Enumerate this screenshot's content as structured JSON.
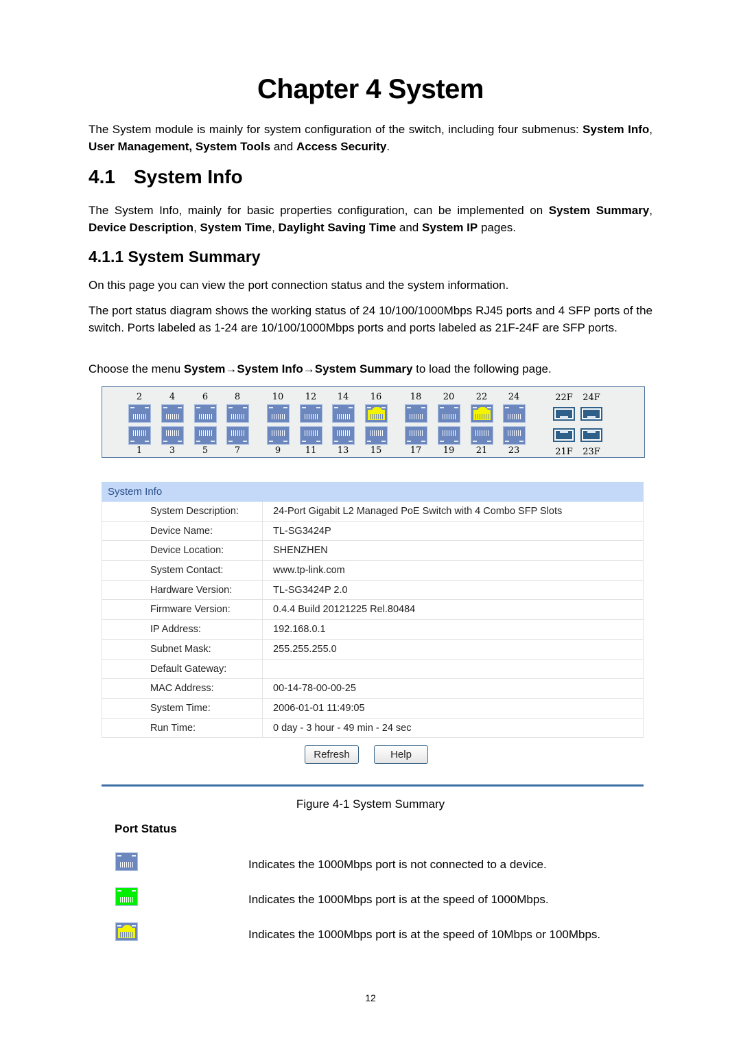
{
  "chapter": {
    "title": "Chapter 4  System"
  },
  "intro": {
    "text_before": "The System module is mainly for system configuration of the switch, including four submenus: ",
    "b1": "System Info",
    "sep1": ", ",
    "b2": "User Management, System Tools",
    "sep2": " and ",
    "b3": "Access Security",
    "end": "."
  },
  "section_4_1": {
    "number": "4.1",
    "title": "System Info",
    "p_before": "The System Info, mainly for basic properties configuration, can be implemented on ",
    "b1": "System Summary",
    "s1": ", ",
    "b2": "Device Description",
    "s2": ", ",
    "b3": "System Time",
    "s3": ", ",
    "b4": "Daylight Saving Time",
    "s4": " and ",
    "b5": "System IP",
    "end": " pages."
  },
  "section_4_1_1": {
    "title": "4.1.1 System Summary",
    "p1": "On this page you can view the port connection status and the system information.",
    "p2": "The port status diagram shows the working status of 24 10/100/1000Mbps RJ45 ports and 4 SFP ports of the switch. Ports labeled as 1-24 are 10/100/1000Mbps ports and ports labeled as 21F-24F are SFP ports.",
    "p3_before": "Choose the menu ",
    "p3_bold": "System→System Info→System Summary",
    "p3_after": " to load the following page."
  },
  "port_panel": {
    "top_labels": [
      "2",
      "4",
      "6",
      "8",
      "10",
      "12",
      "14",
      "16",
      "18",
      "20",
      "22",
      "24"
    ],
    "bottom_labels": [
      "1",
      "3",
      "5",
      "7",
      "9",
      "11",
      "13",
      "15",
      "17",
      "19",
      "21",
      "23"
    ],
    "top_status": [
      "down",
      "down",
      "down",
      "down",
      "down",
      "down",
      "down",
      "10/100",
      "down",
      "down",
      "10/100",
      "down"
    ],
    "bottom_status": [
      "down",
      "down",
      "down",
      "down",
      "down",
      "down",
      "down",
      "down",
      "down",
      "down",
      "down",
      "down"
    ],
    "sfp_top_labels": [
      "22F",
      "24F"
    ],
    "sfp_bottom_labels": [
      "21F",
      "23F"
    ],
    "colors": {
      "down": "#6c87bd",
      "10/100": "#f4f400",
      "1000": "#00ee00",
      "sfp": "#2d5f88"
    }
  },
  "system_info": {
    "header": "System Info",
    "rows": [
      {
        "label": "System Description:",
        "value": "24-Port Gigabit L2 Managed PoE Switch with 4 Combo SFP Slots"
      },
      {
        "label": "Device Name:",
        "value": "TL-SG3424P"
      },
      {
        "label": "Device Location:",
        "value": "SHENZHEN"
      },
      {
        "label": "System Contact:",
        "value": "www.tp-link.com"
      },
      {
        "label": "Hardware Version:",
        "value": "TL-SG3424P 2.0"
      },
      {
        "label": "Firmware Version:",
        "value": "0.4.4 Build 20121225 Rel.80484"
      },
      {
        "label": "IP Address:",
        "value": "192.168.0.1"
      },
      {
        "label": "Subnet Mask:",
        "value": "255.255.255.0"
      },
      {
        "label": "Default Gateway:",
        "value": ""
      },
      {
        "label": "MAC Address:",
        "value": "00-14-78-00-00-25"
      },
      {
        "label": "System Time:",
        "value": "2006-01-01 11:49:05"
      },
      {
        "label": "Run Time:",
        "value": "0 day - 3 hour - 49 min - 24 sec"
      }
    ],
    "refresh_label": "Refresh",
    "help_label": "Help"
  },
  "figure_caption": "Figure 4-1 System Summary",
  "port_status": {
    "title": "Port Status",
    "items": [
      {
        "icon": "port-not-connected-icon",
        "text": "Indicates the 1000Mbps port is not connected to a device."
      },
      {
        "icon": "port-1000mbps-icon",
        "text": "Indicates the 1000Mbps port is at the speed of 1000Mbps."
      },
      {
        "icon": "port-10-100mbps-icon",
        "text": "Indicates the 1000Mbps port is at the speed of 10Mbps or 100Mbps."
      }
    ]
  },
  "page_number": "12"
}
